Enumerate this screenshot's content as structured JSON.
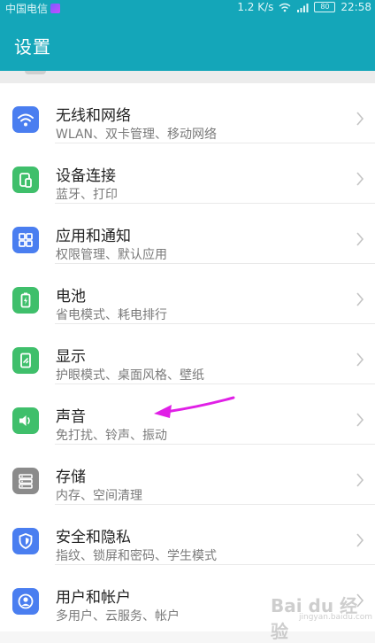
{
  "status_bar": {
    "carrier": "中国电信",
    "speed": "1.2 K/s",
    "battery": "80",
    "time": "22:58"
  },
  "header": {
    "title": "设置"
  },
  "items": [
    {
      "title": "无线和网络",
      "subtitle": "WLAN、双卡管理、移动网络",
      "icon": "wifi-icon",
      "color": "#4a7ef0"
    },
    {
      "title": "设备连接",
      "subtitle": "蓝牙、打印",
      "icon": "device-connect-icon",
      "color": "#3fbf6b"
    },
    {
      "title": "应用和通知",
      "subtitle": "权限管理、默认应用",
      "icon": "apps-grid-icon",
      "color": "#4a7ef0"
    },
    {
      "title": "电池",
      "subtitle": "省电模式、耗电排行",
      "icon": "battery-icon",
      "color": "#3fbf6b"
    },
    {
      "title": "显示",
      "subtitle": "护眼模式、桌面风格、壁纸",
      "icon": "display-icon",
      "color": "#3fbf6b"
    },
    {
      "title": "声音",
      "subtitle": "免打扰、铃声、振动",
      "icon": "speaker-icon",
      "color": "#3fbf6b"
    },
    {
      "title": "存储",
      "subtitle": "内存、空间清理",
      "icon": "storage-icon",
      "color": "#8b8b8b"
    },
    {
      "title": "安全和隐私",
      "subtitle": "指纹、锁屏和密码、学生模式",
      "icon": "shield-icon",
      "color": "#4a7ef0"
    },
    {
      "title": "用户和帐户",
      "subtitle": "多用户、云服务、帐户",
      "icon": "user-account-icon",
      "color": "#4a7ef0"
    }
  ],
  "annotation": {
    "arrow_color": "#e020e6"
  },
  "watermark": {
    "main": "Bai du 经验",
    "sub": "jingyan.baidu.com"
  }
}
